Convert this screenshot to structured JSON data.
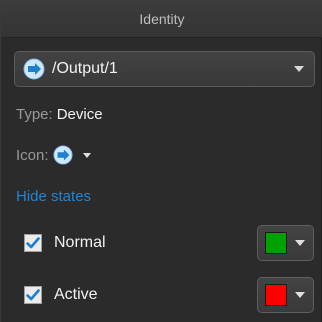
{
  "header": {
    "title": "Identity"
  },
  "entity": {
    "path": "/Output/1",
    "icon": "output-device-icon"
  },
  "type_row": {
    "label": "Type:",
    "value": "Device"
  },
  "icon_row": {
    "label": "Icon:",
    "icon": "output-device-icon"
  },
  "hide_states_label": "Hide states",
  "states": [
    {
      "label": "Normal",
      "checked": true,
      "color": "#00a000"
    },
    {
      "label": "Active",
      "checked": true,
      "color": "#ff0000"
    }
  ],
  "colors": {
    "accent": "#1e86d8",
    "checkbox_check": "#1e7fd0"
  }
}
